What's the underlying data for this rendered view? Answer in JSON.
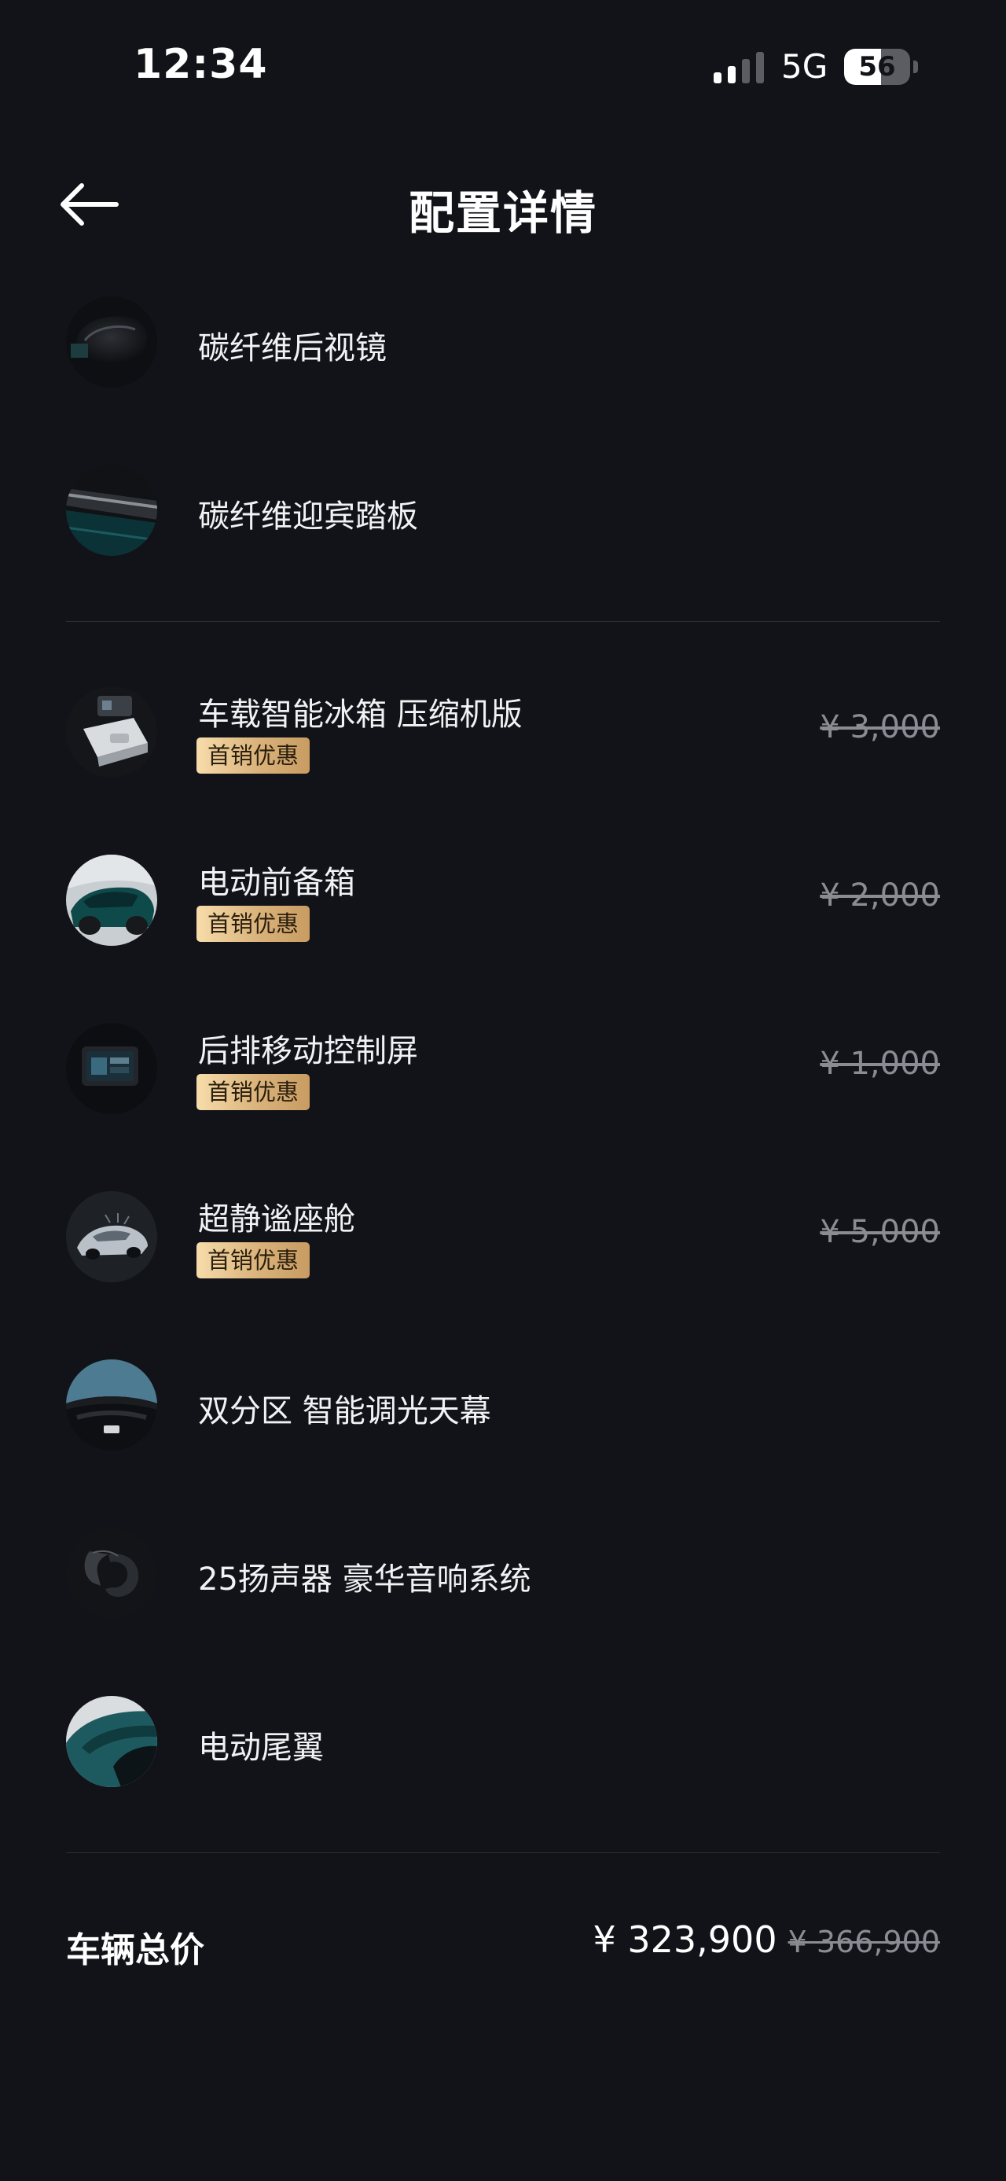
{
  "status_bar": {
    "time": "12:34",
    "network": "5G",
    "battery": "56",
    "battery_level_percent": 56
  },
  "header": {
    "title": "配置详情"
  },
  "standard_items": [
    {
      "name": "碳纤维后视镜",
      "icon": "carbon-mirror-thumbnail"
    },
    {
      "name": "碳纤维迎宾踏板",
      "icon": "carbon-sill-plate-thumbnail"
    }
  ],
  "option_items": [
    {
      "name": "车载智能冰箱 压缩机版",
      "badge": "首销优惠",
      "original_price": "¥ 3,000",
      "icon": "fridge-thumbnail"
    },
    {
      "name": "电动前备箱",
      "badge": "首销优惠",
      "original_price": "¥ 2,000",
      "icon": "front-trunk-thumbnail"
    },
    {
      "name": "后排移动控制屏",
      "badge": "首销优惠",
      "original_price": "¥ 1,000",
      "icon": "rear-screen-thumbnail"
    },
    {
      "name": "超静谧座舱",
      "badge": "首销优惠",
      "original_price": "¥ 5,000",
      "icon": "quiet-cabin-thumbnail"
    },
    {
      "name": "双分区 智能调光天幕",
      "icon": "sunroof-thumbnail"
    },
    {
      "name": "25扬声器 豪华音响系统",
      "icon": "speaker-thumbnail"
    },
    {
      "name": "电动尾翼",
      "icon": "spoiler-thumbnail"
    }
  ],
  "total": {
    "label": "车辆总价",
    "price": "¥ 323,900",
    "original_price": "¥ 366,900"
  },
  "colors": {
    "background": "#121319",
    "badge_gold": "#d9b27a",
    "muted": "#8a8c93"
  }
}
